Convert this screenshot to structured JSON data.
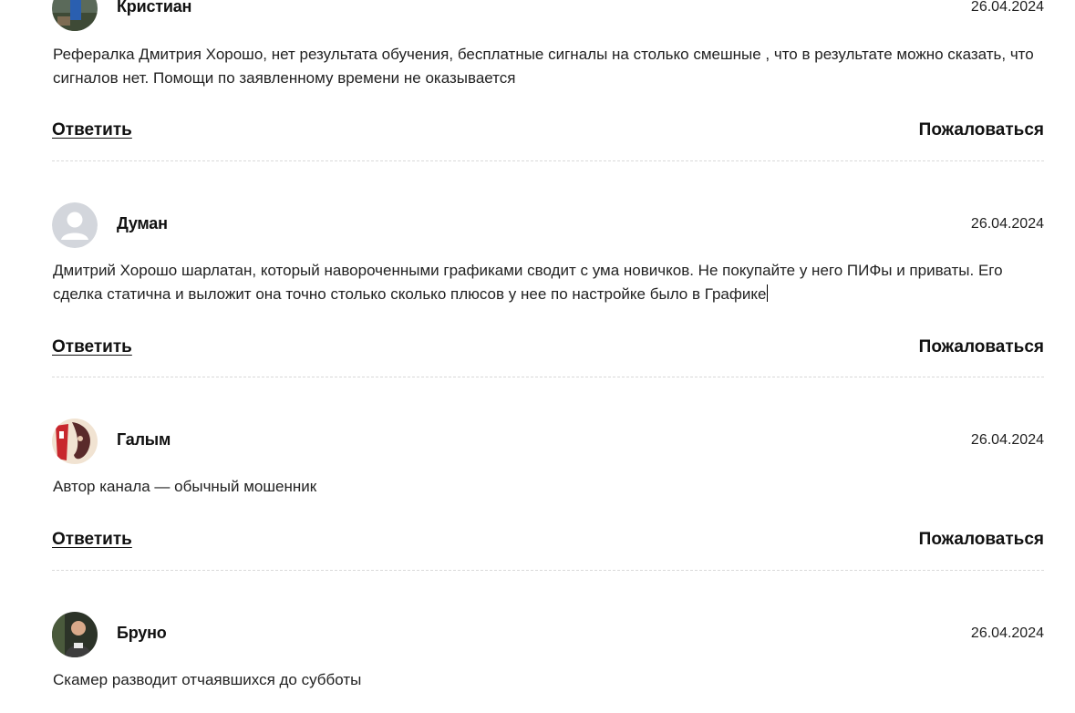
{
  "comments": [
    {
      "author": "Кристиан",
      "date": "26.04.2024",
      "avatar_icon": "user-photo-avatar",
      "text": "Рефералка Дмитрия Хорошо, нет результата обучения, бесплатные сигналы на столько смешные , что в результате можно сказать, что сигналов нет. Помощи по заявленному времени не оказывается",
      "reply_label": "Ответить",
      "report_label": "Пожаловаться"
    },
    {
      "author": "Думан",
      "date": "26.04.2024",
      "avatar_icon": "default-user-icon",
      "text": "Дмитрий Хорошо шарлатан, который навороченными графиками сводит с ума новичков. Не покупайте у него ПИФы и приваты. Его сделка статична и выложит она точно столько сколько плюсов у нее по настройке было в Графике",
      "reply_label": "Ответить",
      "report_label": "Пожаловаться"
    },
    {
      "author": "Галым",
      "date": "26.04.2024",
      "avatar_icon": "user-photo-avatar",
      "text": "Автор канала — обычный мошенник",
      "reply_label": "Ответить",
      "report_label": "Пожаловаться"
    },
    {
      "author": "Бруно",
      "date": "26.04.2024",
      "avatar_icon": "user-photo-avatar",
      "text": "Скамер разводит отчаявшихся до субботы"
    }
  ],
  "colors": {
    "text": "#1f1f1f",
    "link": "#111111",
    "divider": "#d9d9d9",
    "default_avatar_bg": "#d3d6dc",
    "default_avatar_fg": "#ffffff"
  }
}
